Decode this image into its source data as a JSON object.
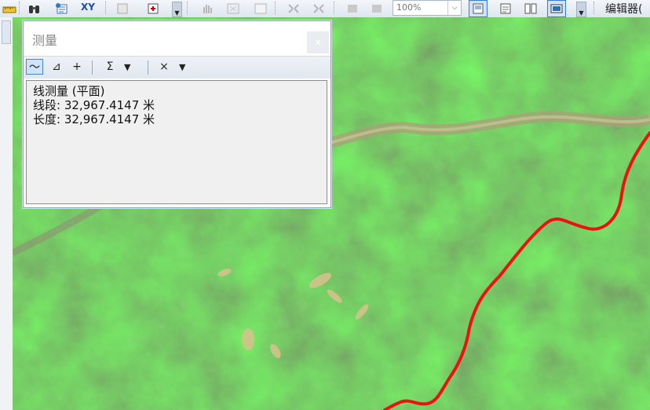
{
  "toolbar": {
    "zoom_value": "100%",
    "xy_label": "XY",
    "editor_label": "编辑器(",
    "icons": [
      "ruler-icon",
      "binoculars-icon",
      "identify-icon",
      "goto-xy-icon",
      "fixed-zoom-icon",
      "add-data-icon",
      "pan-icon",
      "full-extent-icon",
      "select-icon",
      "zoom-in-fixed-icon",
      "zoom-out-fixed-icon",
      "back-extent-icon",
      "forward-extent-icon",
      "layout-view-icon",
      "data-view-icon",
      "report-icon",
      "editor-toolbar-icon"
    ]
  },
  "map": {
    "route_color": "#ee1111"
  },
  "measure": {
    "title": "测量",
    "tools": {
      "line": "〜",
      "area": "⊿",
      "feature": "+",
      "sum": "Σ",
      "clear": "×"
    },
    "result": {
      "heading": "线测量 (平面)",
      "segment_label": "线段",
      "segment_value": "32,967.4147 米",
      "length_label": "长度",
      "length_value": "32,967.4147 米"
    }
  }
}
